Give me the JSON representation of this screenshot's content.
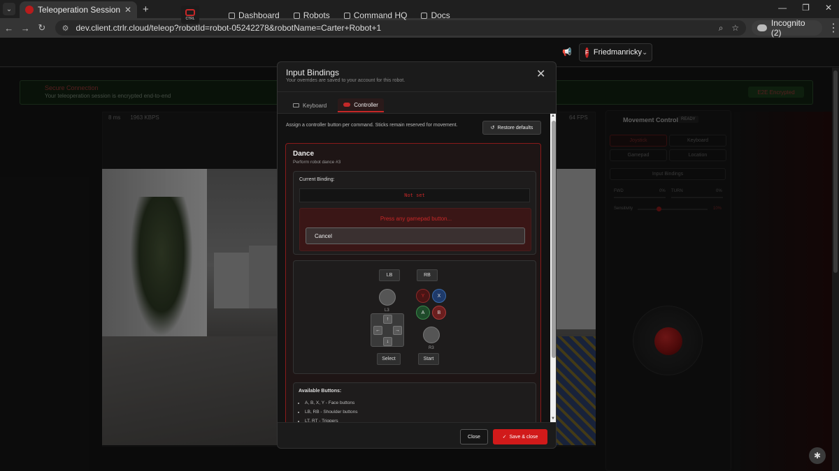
{
  "browser": {
    "tab_title": "Teleoperation Session | C",
    "url": "dev.client.ctrlr.cloud/teleop?robotId=robot-05242278&robotName=Carter+Robot+1",
    "incognito_label": "Incognito (2)"
  },
  "header": {
    "logo_text": "CTRL",
    "nav": [
      "Dashboard",
      "Robots",
      "Command HQ",
      "Docs"
    ],
    "user_initial": "F",
    "user_name": "Friedmanricky"
  },
  "background": {
    "secure_title": "Secure Connection",
    "secure_sub": "Your teleoperation session is encrypted end-to-end",
    "secure_badge": "E2E Encrypted",
    "stats_ms": "8",
    "stats_ms_unit": "ms",
    "stats_kbps": "1963",
    "stats_kbps_unit": "KBPS",
    "stats_fps": "64",
    "stats_fps_unit": "FPS",
    "panel_title": "Movement Control",
    "panel_badge": "READY",
    "panel_buttons": [
      "Joystick",
      "Keyboard",
      "Gamepad",
      "Location"
    ],
    "input_bindings_btn": "Input Bindings",
    "fwd_label": "FWD",
    "fwd_val": "0%",
    "turn_label": "TURN",
    "turn_val": "0%",
    "sensitivity_label": "Sensitivity",
    "sensitivity_val": "10%"
  },
  "modal": {
    "title": "Input Bindings",
    "subtitle": "Your overrides are saved to your account for this robot.",
    "tabs": [
      "Keyboard",
      "Controller"
    ],
    "active_tab": "Controller",
    "hint": "Assign a controller button per command. Sticks remain reserved for movement.",
    "restore_label": "Restore defaults",
    "command": {
      "title": "Dance",
      "subtitle": "Perform robot dance #3",
      "current_binding_label": "Current Binding:",
      "current_binding_value": "Not set",
      "listening_text": "Press any gamepad button...",
      "cancel_label": "Cancel"
    },
    "controller": {
      "lb": "LB",
      "rb": "RB",
      "l3": "L3",
      "r3": "R3",
      "y": "Y",
      "x": "X",
      "a": "A",
      "b": "B",
      "up": "↑",
      "down": "↓",
      "left": "←",
      "right": "→",
      "select": "Select",
      "start": "Start"
    },
    "available": {
      "title": "Available Buttons:",
      "items": [
        "A, B, X, Y - Face buttons",
        "LB, RB - Shoulder buttons",
        "LT, RT - Triggers"
      ]
    },
    "close_label": "Close",
    "save_label": "Save & close"
  },
  "colors": {
    "accent": "#c62828",
    "save": "#d11a1a",
    "face_x": "#1e3a6a",
    "face_a": "#1e4a2a",
    "face_b": "#6a1e1e"
  }
}
